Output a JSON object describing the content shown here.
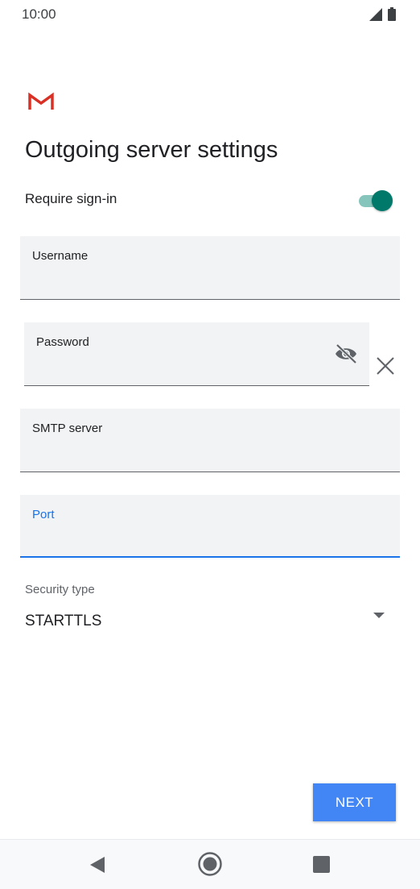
{
  "status_bar": {
    "time": "10:00"
  },
  "page": {
    "title": "Outgoing server settings"
  },
  "require_signin": {
    "label": "Require sign-in",
    "enabled": true
  },
  "fields": {
    "username": {
      "label": "Username",
      "value": ""
    },
    "password": {
      "label": "Password",
      "value": ""
    },
    "smtp_server": {
      "label": "SMTP server",
      "value": ""
    },
    "port": {
      "label": "Port",
      "value": ""
    }
  },
  "security": {
    "label": "Security type",
    "selected": "STARTTLS"
  },
  "actions": {
    "next_label": "NEXT"
  },
  "icons": {
    "logo": "gmail-logo-icon",
    "visibility": "visibility-off-icon",
    "clear": "close-icon",
    "dropdown": "dropdown-arrow-icon",
    "nav_back": "back-icon",
    "nav_home": "home-icon",
    "nav_recent": "recents-icon"
  },
  "colors": {
    "accent": "#1a73e8",
    "toggle": "#00796b",
    "button": "#4285f4"
  }
}
